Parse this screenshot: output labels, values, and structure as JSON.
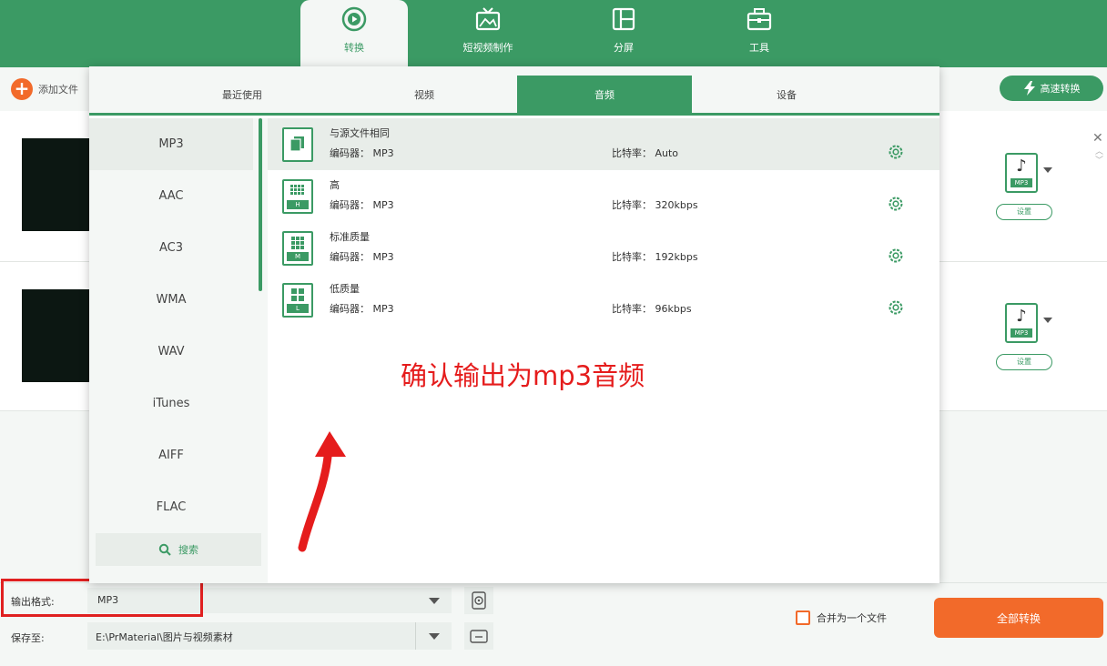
{
  "nav": {
    "tabs": [
      {
        "label": "转换",
        "icon": "convert-icon",
        "active": true
      },
      {
        "label": "短视频制作",
        "icon": "tv-icon",
        "active": false
      },
      {
        "label": "分屏",
        "icon": "split-screen-icon",
        "active": false
      },
      {
        "label": "工具",
        "icon": "toolbox-icon",
        "active": false
      }
    ]
  },
  "toolbar": {
    "add_file_label": "添加文件",
    "fast_convert_label": "高速转换"
  },
  "file_rows": [
    {
      "format_tag": "MP3",
      "settings_label": "设置"
    },
    {
      "format_tag": "MP3",
      "settings_label": "设置"
    }
  ],
  "popup": {
    "tabs": [
      {
        "label": "最近使用",
        "active": false
      },
      {
        "label": "视频",
        "active": false
      },
      {
        "label": "音频",
        "active": true
      },
      {
        "label": "设备",
        "active": false
      }
    ],
    "formats": [
      "MP3",
      "AAC",
      "AC3",
      "WMA",
      "WAV",
      "iTunes",
      "AIFF",
      "FLAC"
    ],
    "selected_format": "MP3",
    "search_label": "搜索",
    "presets": [
      {
        "name": "与源文件相同",
        "codec_label": "编码器：",
        "codec": "MP3",
        "bitrate_label": "比特率：",
        "bitrate": "Auto",
        "level": ""
      },
      {
        "name": "高",
        "codec_label": "编码器：",
        "codec": "MP3",
        "bitrate_label": "比特率：",
        "bitrate": "320kbps",
        "level": "H"
      },
      {
        "name": "标准质量",
        "codec_label": "编码器：",
        "codec": "MP3",
        "bitrate_label": "比特率：",
        "bitrate": "192kbps",
        "level": "M"
      },
      {
        "name": "低质量",
        "codec_label": "编码器：",
        "codec": "MP3",
        "bitrate_label": "比特率：",
        "bitrate": "96kbps",
        "level": "L"
      }
    ]
  },
  "annotation": {
    "text": "确认输出为mp3音频",
    "color": "#e51c1c"
  },
  "bottom": {
    "output_format_label": "输出格式:",
    "output_format_value": "MP3",
    "save_to_label": "保存至:",
    "save_to_value": "E:\\PrMaterial\\图片与视频素材",
    "merge_label": "合并为一个文件",
    "convert_all_label": "全部转换"
  },
  "colors": {
    "brand_green": "#3b9a64",
    "accent_orange": "#f26a2a",
    "highlight_red": "#e02020"
  }
}
